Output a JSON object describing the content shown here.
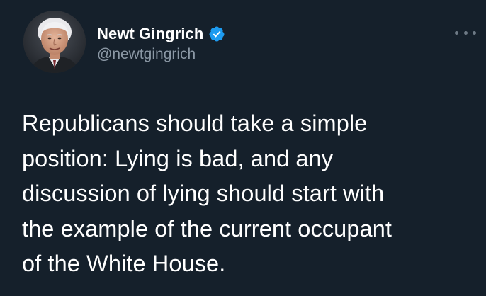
{
  "tweet": {
    "author": {
      "display_name": "Newt Gingrich",
      "handle": "@newtgingrich",
      "verified": true,
      "avatar_icon": "profile-photo"
    },
    "text_lines": [
      "Republicans should take a simple",
      "position: Lying is bad, and any",
      "discussion of lying should start with",
      "the example of the current occupant",
      "of the White House."
    ],
    "more_icon": "more-options-icon"
  },
  "colors": {
    "background": "#15202b",
    "text": "#ffffff",
    "secondary_text": "#8b98a5",
    "verified_badge": "#1d9bf0"
  }
}
